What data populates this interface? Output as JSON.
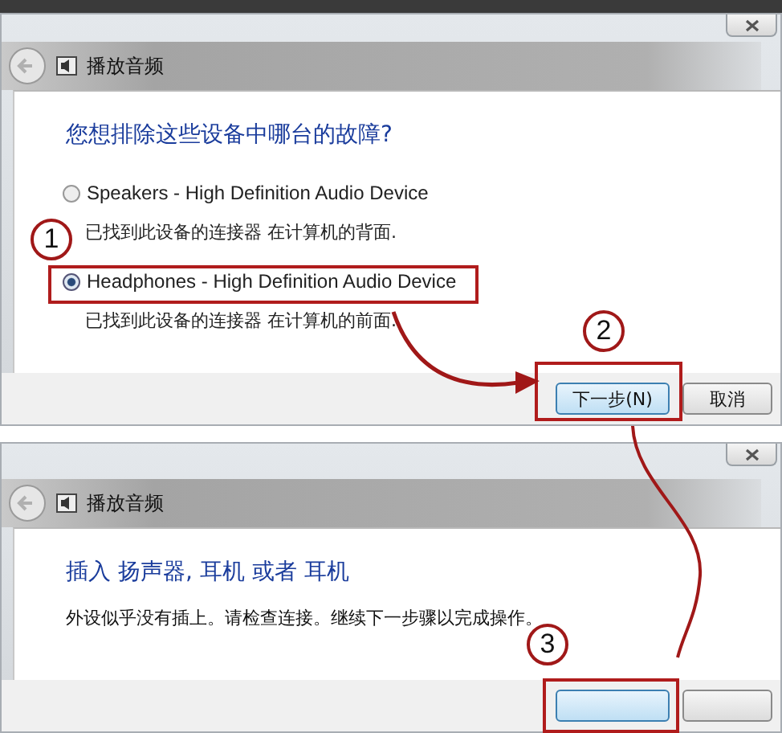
{
  "dialogs": [
    {
      "title": "播放音频",
      "heading": "您想排除这些设备中哪台的故障?",
      "options": [
        {
          "label": "Speakers - High Definition Audio Device",
          "note": "已找到此设备的连接器 在计算机的背面.",
          "selected": false
        },
        {
          "label": "Headphones - High Definition Audio Device",
          "note": "已找到此设备的连接器 在计算机的前面.",
          "selected": true
        }
      ],
      "buttons": [
        {
          "label": "下一步(N)",
          "default": true
        },
        {
          "label": "取消",
          "default": false
        }
      ]
    },
    {
      "title": "播放音频",
      "heading": "插入 扬声器, 耳机 或者 耳机",
      "message": "外设似乎没有插上。请检查连接。继续下一步骤以完成操作。",
      "buttons": [
        {
          "default": true
        },
        {
          "default": false
        }
      ]
    }
  ],
  "annotations": [
    {
      "label": "1"
    },
    {
      "label": "2"
    },
    {
      "label": "3"
    }
  ]
}
